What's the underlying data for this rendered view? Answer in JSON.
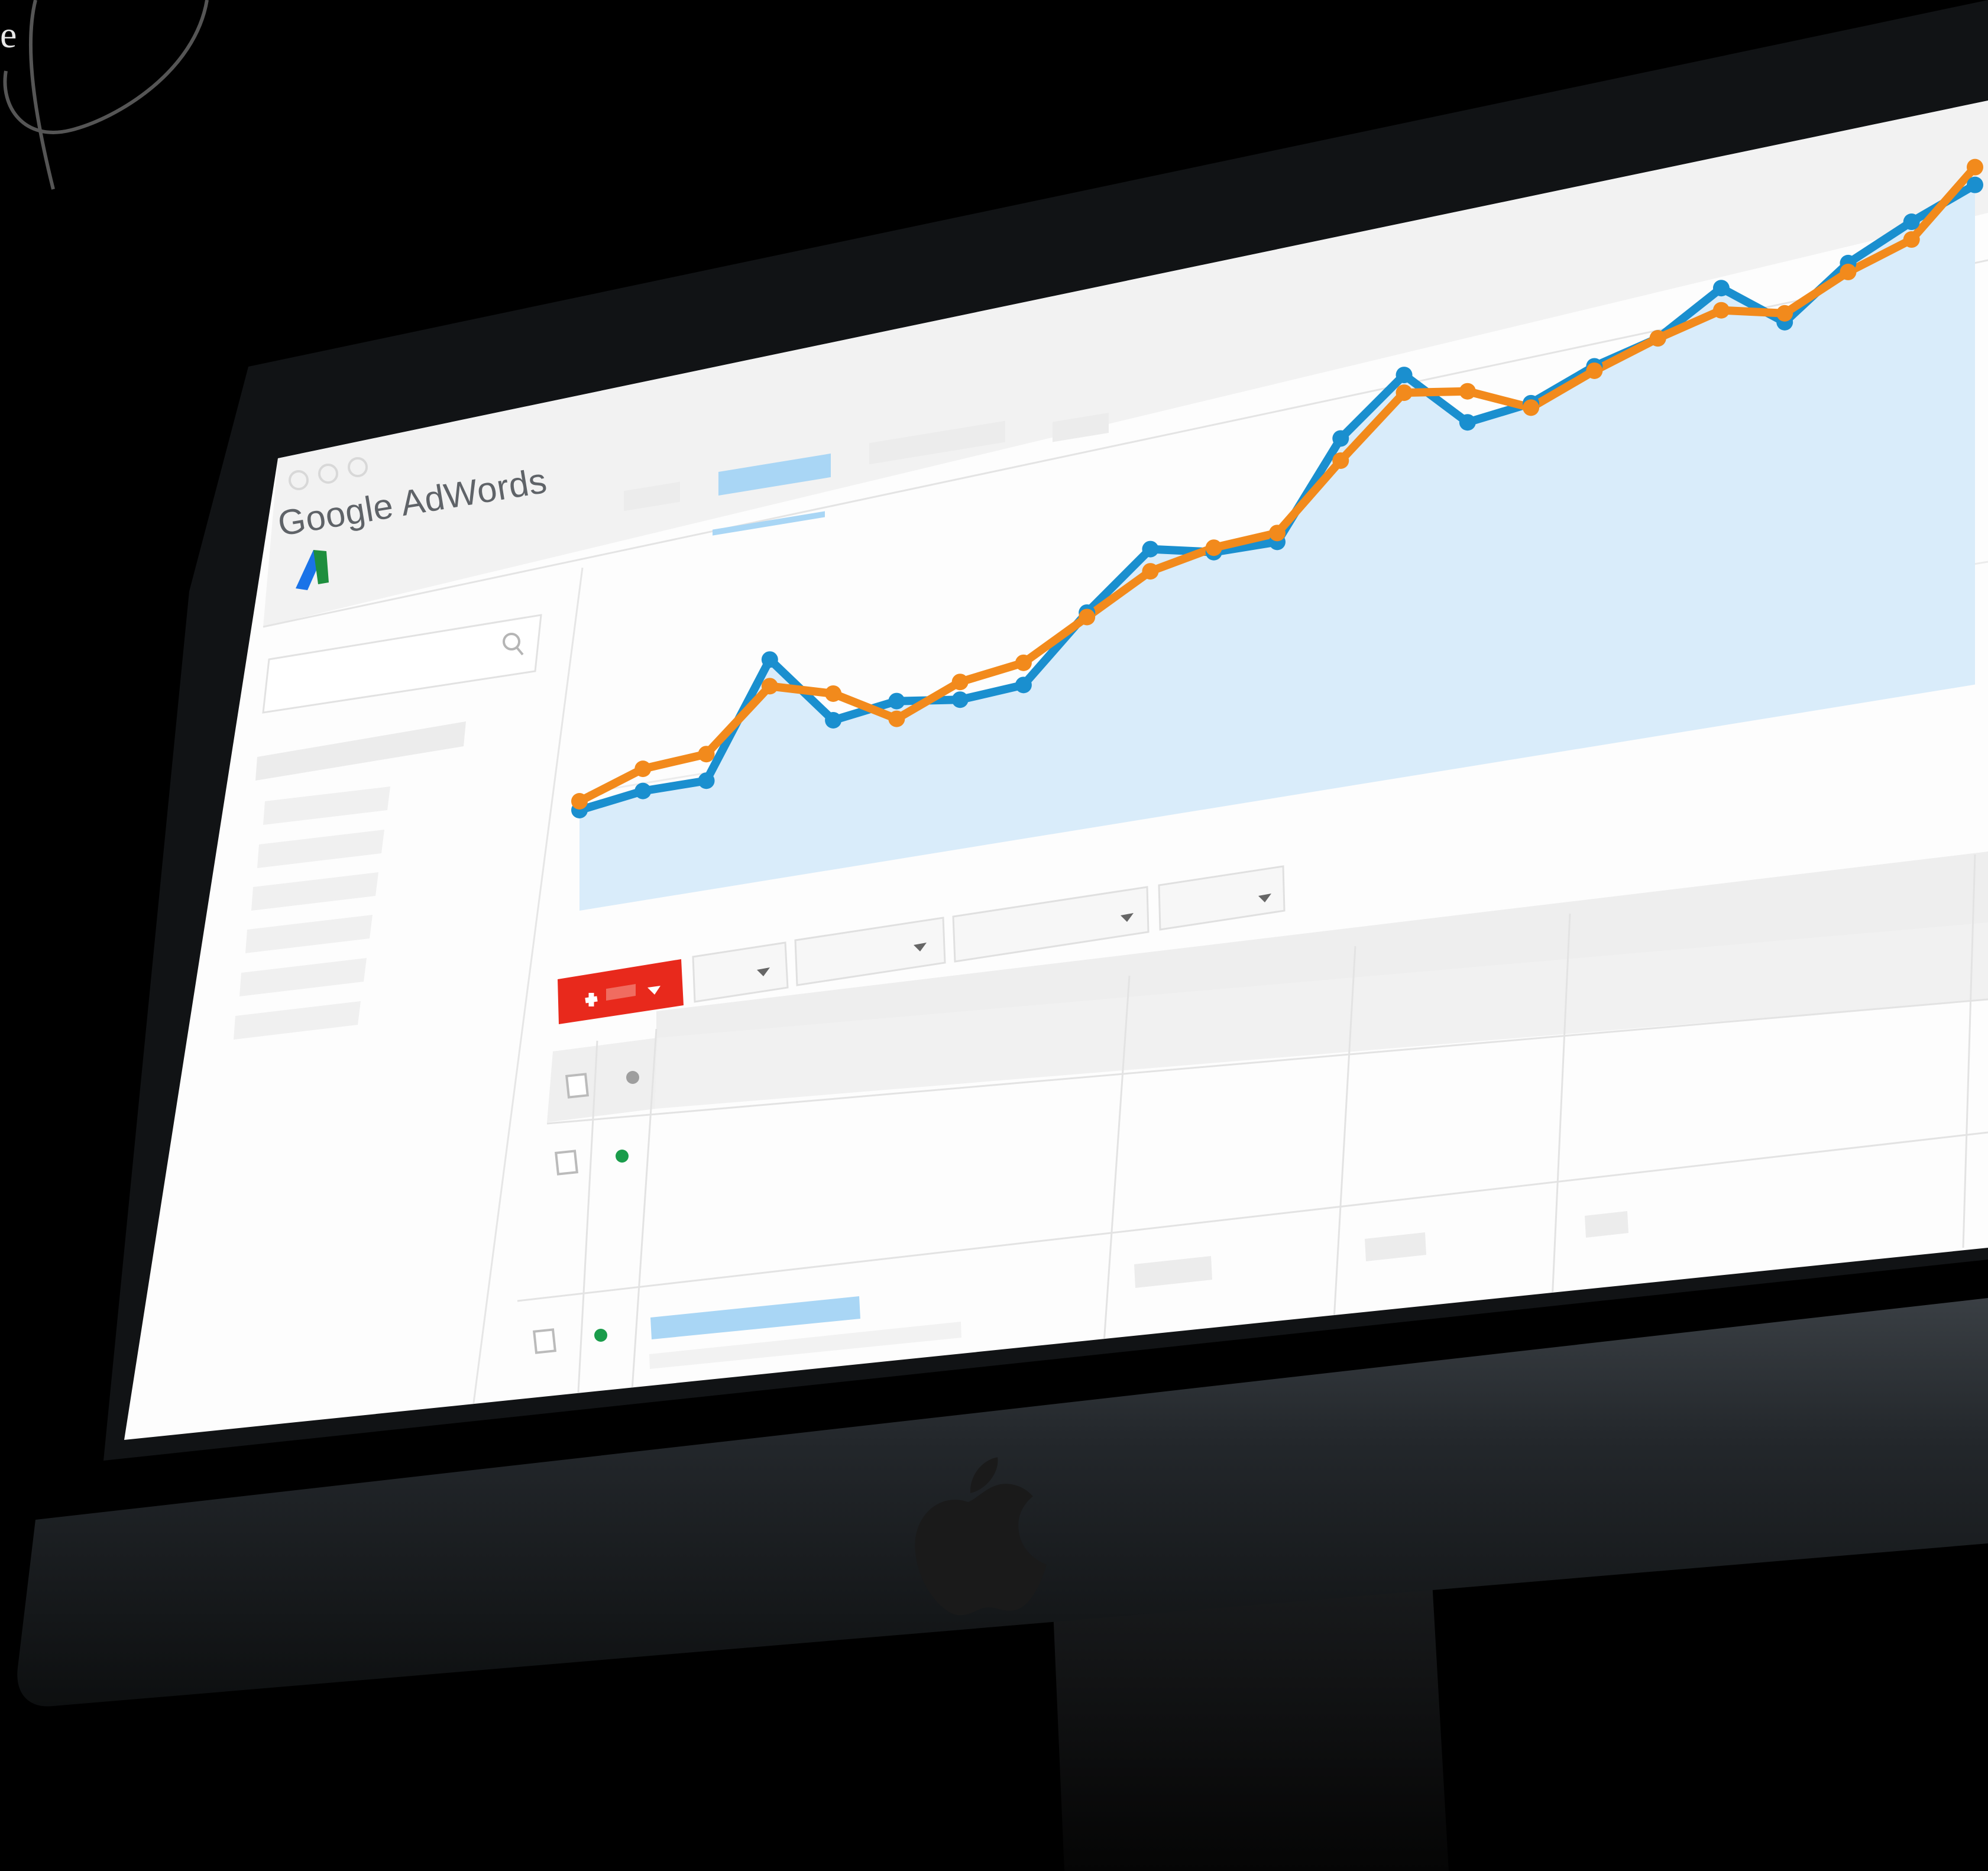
{
  "overlay_text": "e",
  "app": {
    "brand": "Google AdWords"
  },
  "logo": {
    "colors": {
      "blue": "#1a73e8",
      "green": "#1e8e3e"
    }
  },
  "search": {
    "icon": "search-icon"
  },
  "toolbar": {
    "add_icon": "plus-icon",
    "dropdown_icon": "caret-down-icon"
  },
  "table": {
    "rows": [
      {
        "status": "enabled",
        "status_color": "#1a9c4b"
      },
      {
        "status": "enabled",
        "status_color": "#1a9c4b"
      }
    ],
    "header_status_color": "#9e9e9e"
  },
  "colors": {
    "series_a": "#1a8fcf",
    "series_b": "#f28a1c",
    "area": "#d9ecfa",
    "add_button": "#e8291c",
    "selected_tab": "#a9d6f5"
  },
  "chart_data": {
    "type": "line",
    "series": [
      {
        "values": [
          20,
          22,
          22,
          47,
          31,
          33,
          31,
          32,
          46,
          58,
          55,
          55,
          76,
          88,
          75,
          77,
          83,
          87,
          96,
          86,
          97,
          104,
          110
        ]
      },
      {
        "values": [
          22,
          27,
          28,
          41,
          37,
          29,
          35,
          37,
          45,
          53,
          56,
          57,
          71,
          84,
          82,
          76,
          82,
          87,
          91,
          88,
          95,
          100,
          114
        ]
      }
    ],
    "area_under": "series_a",
    "grid": false,
    "axes_visible": false
  }
}
